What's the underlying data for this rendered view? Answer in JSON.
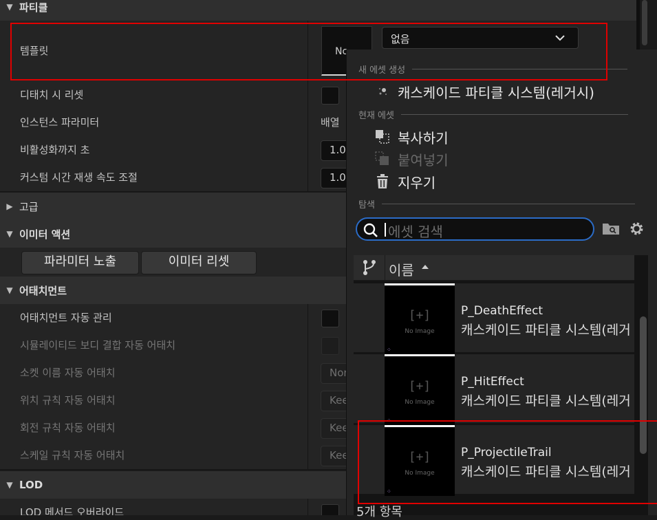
{
  "details": {
    "sections": {
      "particle": "파티클",
      "advanced": "고급",
      "emitter_actions": "이미터 액션",
      "attachment": "어태치먼트",
      "lod": "LOD"
    },
    "rows": {
      "template": "템플릿",
      "template_thumb_text": "No",
      "template_value": "없음",
      "reset_on_detach": "디태치 시 리셋",
      "instance_parameters": "인스턴스 파라미터",
      "instance_parameters_value": "배열",
      "seconds_before_inactive": "비활성화까지 초",
      "seconds_before_inactive_value": "1.0",
      "custom_time_dilation": "커스텀 시간 재생 속도 조절",
      "custom_time_dilation_value": "1.0",
      "auto_manage_attachment": "어태치먼트 자동 관리",
      "auto_attach_weld_simulated": "시뮬레이티드 보디 결합 자동 어태치",
      "auto_attach_socket_name": "소켓 이름 자동 어태치",
      "auto_attach_socket_value": "Nor",
      "auto_attach_location_rule": "위치 규칙 자동 어태치",
      "auto_attach_rotation_rule": "회전 규칙 자동 어태치",
      "auto_attach_scale_rule": "스케일 규칙 자동 어태치",
      "rule_value": "Kee",
      "lod_method_override": "LOD 메서드 오버라이드"
    },
    "buttons": {
      "expose_parameter": "파라미터 노출",
      "reset_emitter": "이미터 리셋"
    }
  },
  "popup": {
    "sections": {
      "create_new": "새 에셋 생성",
      "current": "현재 에셋",
      "browse": "탐색"
    },
    "menu": {
      "cascade_legacy": "캐스케이드 파티클 시스템(레거시)",
      "copy": "복사하기",
      "paste": "붙여넣기",
      "clear": "지우기"
    },
    "search": {
      "placeholder": "에셋 검색"
    },
    "list": {
      "column_name": "이름",
      "assets": [
        {
          "name": "P_DeathEffect",
          "type": "캐스케이드 파티클 시스템(레거"
        },
        {
          "name": "P_HitEffect",
          "type": "캐스케이드 파티클 시스템(레거"
        },
        {
          "name": "P_ProjectileTrail",
          "type": "캐스케이드 파티클 시스템(레거"
        }
      ],
      "thumb_plus": "[+]",
      "thumb_noimage": "No Image",
      "thumb_dots": "⁘"
    },
    "count": "5개 항목"
  },
  "colors": {
    "highlight": "#e00000",
    "search_border": "#2b6cc8",
    "panel_bg": "#242424",
    "category_bg": "#2f2f2f"
  }
}
